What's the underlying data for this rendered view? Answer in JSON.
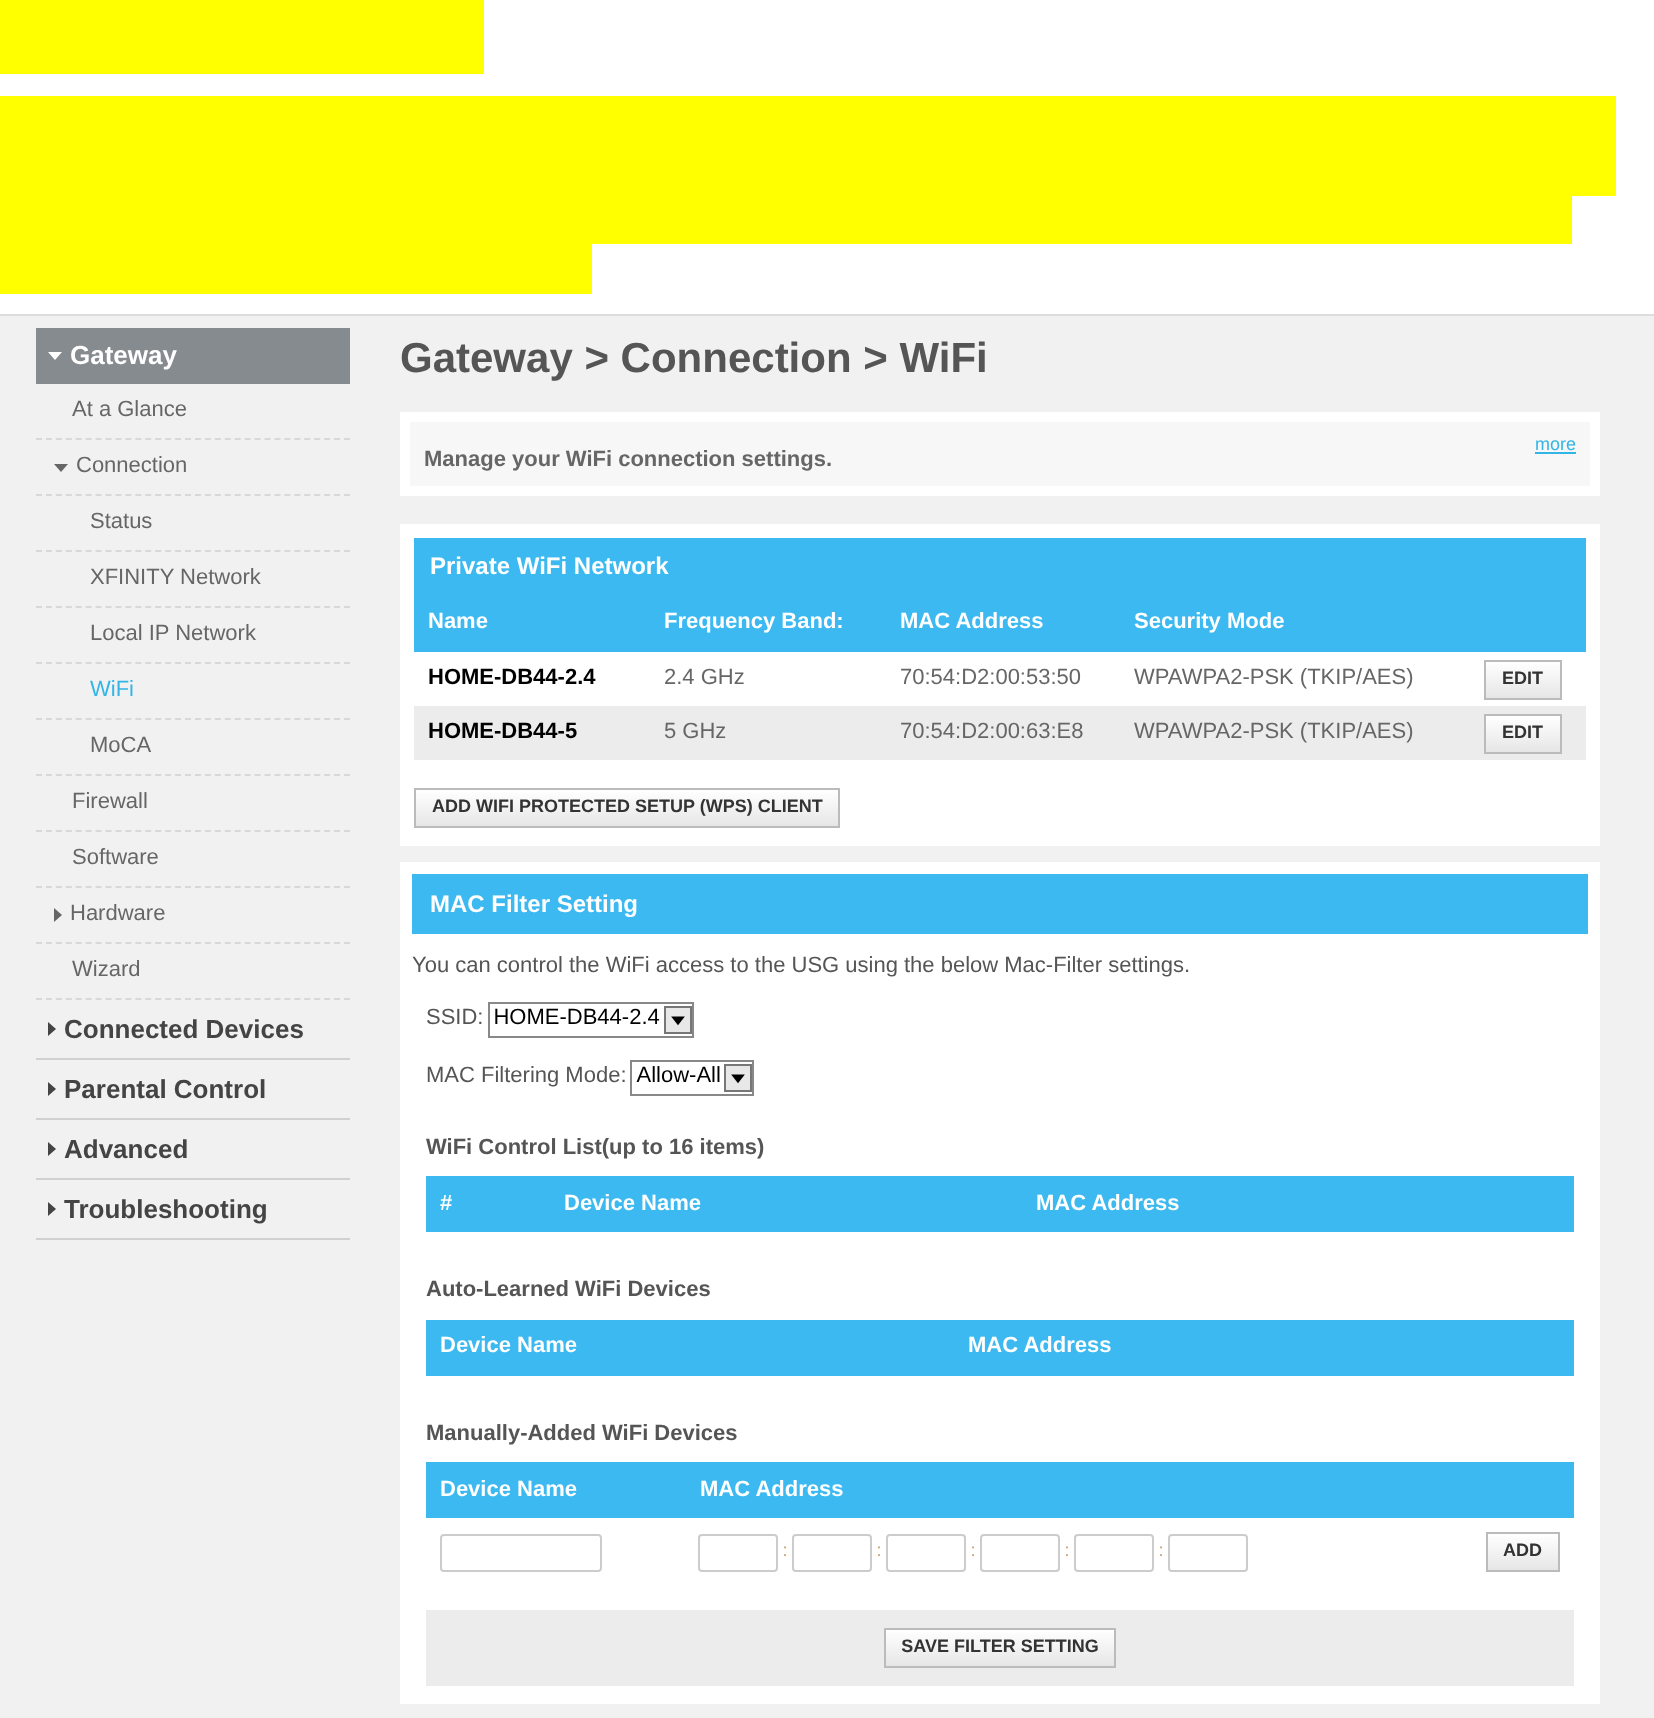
{
  "sidebar": {
    "items": [
      {
        "label": "Gateway",
        "expanded": true,
        "selected": false,
        "children": [
          {
            "label": "At a Glance",
            "selected": false
          },
          {
            "label": "Connection",
            "expanded": true,
            "selected": false,
            "children": [
              {
                "label": "Status",
                "selected": false
              },
              {
                "label": "XFINITY Network",
                "selected": false
              },
              {
                "label": "Local IP Network",
                "selected": false
              },
              {
                "label": "WiFi",
                "selected": true
              },
              {
                "label": "MoCA",
                "selected": false
              }
            ]
          },
          {
            "label": "Firewall",
            "selected": false
          },
          {
            "label": "Software",
            "selected": false
          },
          {
            "label": "Hardware",
            "expanded": false,
            "selected": false
          },
          {
            "label": "Wizard",
            "selected": false
          }
        ]
      },
      {
        "label": "Connected Devices",
        "expanded": false,
        "selected": false
      },
      {
        "label": "Parental Control",
        "expanded": false,
        "selected": false
      },
      {
        "label": "Advanced",
        "expanded": false,
        "selected": false
      },
      {
        "label": "Troubleshooting",
        "expanded": false,
        "selected": false
      }
    ]
  },
  "page_title": "Gateway > Connection > WiFi",
  "intro": {
    "text": "Manage your WiFi connection settings.",
    "link": "more"
  },
  "private_wifi": {
    "title": "Private WiFi Network",
    "columns": [
      "Name",
      "Frequency Band:",
      "MAC Address",
      "Security Mode"
    ],
    "rows": [
      {
        "name": "HOME-DB44-2.4",
        "band": "2.4 GHz",
        "mac": "70:54:D2:00:53:50",
        "security": "WPAWPA2-PSK (TKIP/AES)",
        "button": "EDIT"
      },
      {
        "name": "HOME-DB44-5",
        "band": "5 GHz",
        "mac": "70:54:D2:00:63:E8",
        "security": "WPAWPA2-PSK (TKIP/AES)",
        "button": "EDIT"
      }
    ],
    "add_button": "ADD WIFI PROTECTED SETUP (WPS) CLIENT"
  },
  "mac_filter": {
    "title": "MAC Filter Setting",
    "description": "You can control the WiFi access to the USG using the below Mac-Filter settings.",
    "ssid": {
      "label": "SSID:",
      "value": "HOME-DB44-2.4"
    },
    "mode": {
      "label": "MAC Filtering Mode:",
      "value": "Allow-All"
    },
    "control_list": {
      "title": "WiFi Control List(up to 16 items)",
      "columns": [
        "#",
        "Device Name",
        "MAC Address"
      ]
    },
    "auto_learned": {
      "title": "Auto-Learned WiFi Devices",
      "columns": [
        "Device Name",
        "MAC Address"
      ]
    },
    "manual": {
      "title": "Manually-Added WiFi Devices",
      "columns": [
        "Device Name",
        "MAC Address"
      ],
      "separators": [
        ":",
        ":",
        ":",
        ":",
        ":"
      ],
      "add_button": "ADD"
    },
    "save_button": "SAVE FILTER SETTING"
  }
}
